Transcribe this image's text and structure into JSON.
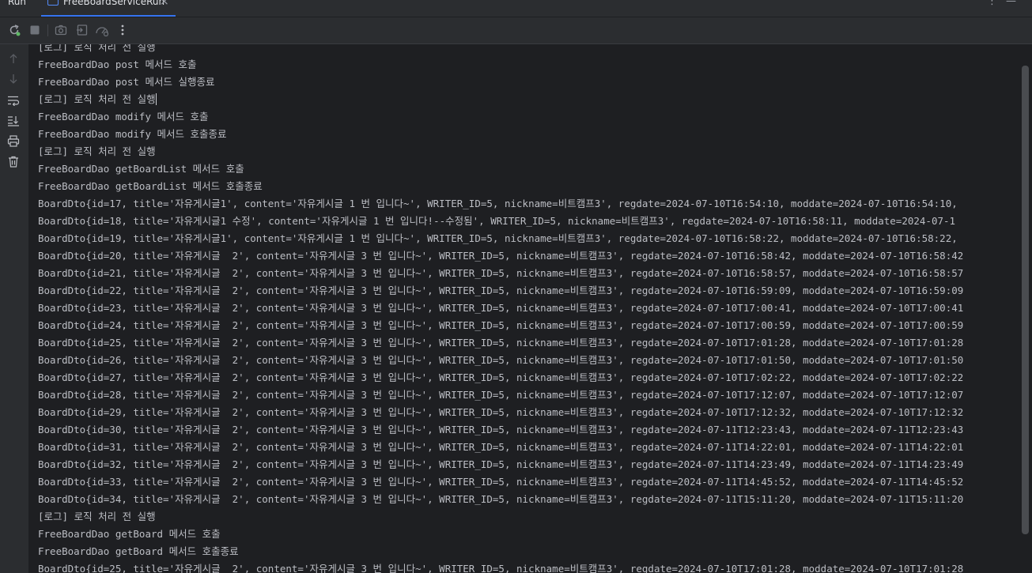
{
  "window": {
    "tool_label": "Run",
    "tab_label": "FreeBoardServiceRun",
    "tab_close": "×",
    "more_icon": "⋮",
    "minimize_icon": "—"
  },
  "toolbar": {
    "icons": [
      "rerun-icon",
      "stop-icon",
      "camera-icon",
      "exit-icon",
      "dashboard-icon",
      "more-vertical-icon"
    ]
  },
  "sidebar": {
    "icons": [
      "arrow-up-icon",
      "arrow-down-icon",
      "soft-wrap-icon",
      "scroll-to-end-icon",
      "print-icon",
      "trash-icon"
    ]
  },
  "console": {
    "lines": [
      "[로그] 로직 처리 전 실행",
      "FreeBoardDao post 메서드 호출",
      "FreeBoardDao post 메서드 실행종료",
      "[로그] 로직 처리 전 실행",
      "FreeBoardDao modify 메서드 호출",
      "FreeBoardDao modify 메서드 호출종료",
      "[로그] 로직 처리 전 실행",
      "FreeBoardDao getBoardList 메서드 호출",
      "FreeBoardDao getBoardList 메서드 호출종료",
      "BoardDto{id=17, title='자유게시글1', content='자유게시글 1 번 입니다~', WRITER_ID=5, nickname=비트캠프3', regdate=2024-07-10T16:54:10, moddate=2024-07-10T16:54:10,",
      "BoardDto{id=18, title='자유게시글1 수정', content='자유게시글 1 번 입니다!--수정됨', WRITER_ID=5, nickname=비트캠프3', regdate=2024-07-10T16:58:11, moddate=2024-07-1",
      "BoardDto{id=19, title='자유게시글1', content='자유게시글 1 번 입니다~', WRITER_ID=5, nickname=비트캠프3', regdate=2024-07-10T16:58:22, moddate=2024-07-10T16:58:22,",
      "BoardDto{id=20, title='자유게시글  2', content='자유게시글 3 번 입니다~', WRITER_ID=5, nickname=비트캠프3', regdate=2024-07-10T16:58:42, moddate=2024-07-10T16:58:42",
      "BoardDto{id=21, title='자유게시글  2', content='자유게시글 3 번 입니다~', WRITER_ID=5, nickname=비트캠프3', regdate=2024-07-10T16:58:57, moddate=2024-07-10T16:58:57",
      "BoardDto{id=22, title='자유게시글  2', content='자유게시글 3 번 입니다~', WRITER_ID=5, nickname=비트캠프3', regdate=2024-07-10T16:59:09, moddate=2024-07-10T16:59:09",
      "BoardDto{id=23, title='자유게시글  2', content='자유게시글 3 번 입니다~', WRITER_ID=5, nickname=비트캠프3', regdate=2024-07-10T17:00:41, moddate=2024-07-10T17:00:41",
      "BoardDto{id=24, title='자유게시글  2', content='자유게시글 3 번 입니다~', WRITER_ID=5, nickname=비트캠프3', regdate=2024-07-10T17:00:59, moddate=2024-07-10T17:00:59",
      "BoardDto{id=25, title='자유게시글  2', content='자유게시글 3 번 입니다~', WRITER_ID=5, nickname=비트캠프3', regdate=2024-07-10T17:01:28, moddate=2024-07-10T17:01:28",
      "BoardDto{id=26, title='자유게시글  2', content='자유게시글 3 번 입니다~', WRITER_ID=5, nickname=비트캠프3', regdate=2024-07-10T17:01:50, moddate=2024-07-10T17:01:50",
      "BoardDto{id=27, title='자유게시글  2', content='자유게시글 3 번 입니다~', WRITER_ID=5, nickname=비트캠프3', regdate=2024-07-10T17:02:22, moddate=2024-07-10T17:02:22",
      "BoardDto{id=28, title='자유게시글  2', content='자유게시글 3 번 입니다~', WRITER_ID=5, nickname=비트캠프3', regdate=2024-07-10T17:12:07, moddate=2024-07-10T17:12:07",
      "BoardDto{id=29, title='자유게시글  2', content='자유게시글 3 번 입니다~', WRITER_ID=5, nickname=비트캠프3', regdate=2024-07-10T17:12:32, moddate=2024-07-10T17:12:32",
      "BoardDto{id=30, title='자유게시글  2', content='자유게시글 3 번 입니다~', WRITER_ID=5, nickname=비트캠프3', regdate=2024-07-11T12:23:43, moddate=2024-07-11T12:23:43",
      "BoardDto{id=31, title='자유게시글  2', content='자유게시글 3 번 입니다~', WRITER_ID=5, nickname=비트캠프3', regdate=2024-07-11T14:22:01, moddate=2024-07-11T14:22:01",
      "BoardDto{id=32, title='자유게시글  2', content='자유게시글 3 번 입니다~', WRITER_ID=5, nickname=비트캠프3', regdate=2024-07-11T14:23:49, moddate=2024-07-11T14:23:49",
      "BoardDto{id=33, title='자유게시글  2', content='자유게시글 3 번 입니다~', WRITER_ID=5, nickname=비트캠프3', regdate=2024-07-11T14:45:52, moddate=2024-07-11T14:45:52",
      "BoardDto{id=34, title='자유게시글  2', content='자유게시글 3 번 입니다~', WRITER_ID=5, nickname=비트캠프3', regdate=2024-07-11T15:11:20, moddate=2024-07-11T15:11:20",
      "[로그] 로직 처리 전 실행",
      "FreeBoardDao getBoard 메서드 호출",
      "FreeBoardDao getBoard 메서드 호출종료",
      "BoardDto{id=25, title='자유게시글  2', content='자유게시글 3 번 입니다~', WRITER_ID=5, nickname=비트캠프3', regdate=2024-07-10T17:01:28, moddate=2024-07-10T17:01:28"
    ],
    "caret_line": 3
  },
  "colors": {
    "background": "#1e1f22",
    "panel": "#2b2d30",
    "text": "#bcbec4",
    "accent": "#3574f0"
  }
}
